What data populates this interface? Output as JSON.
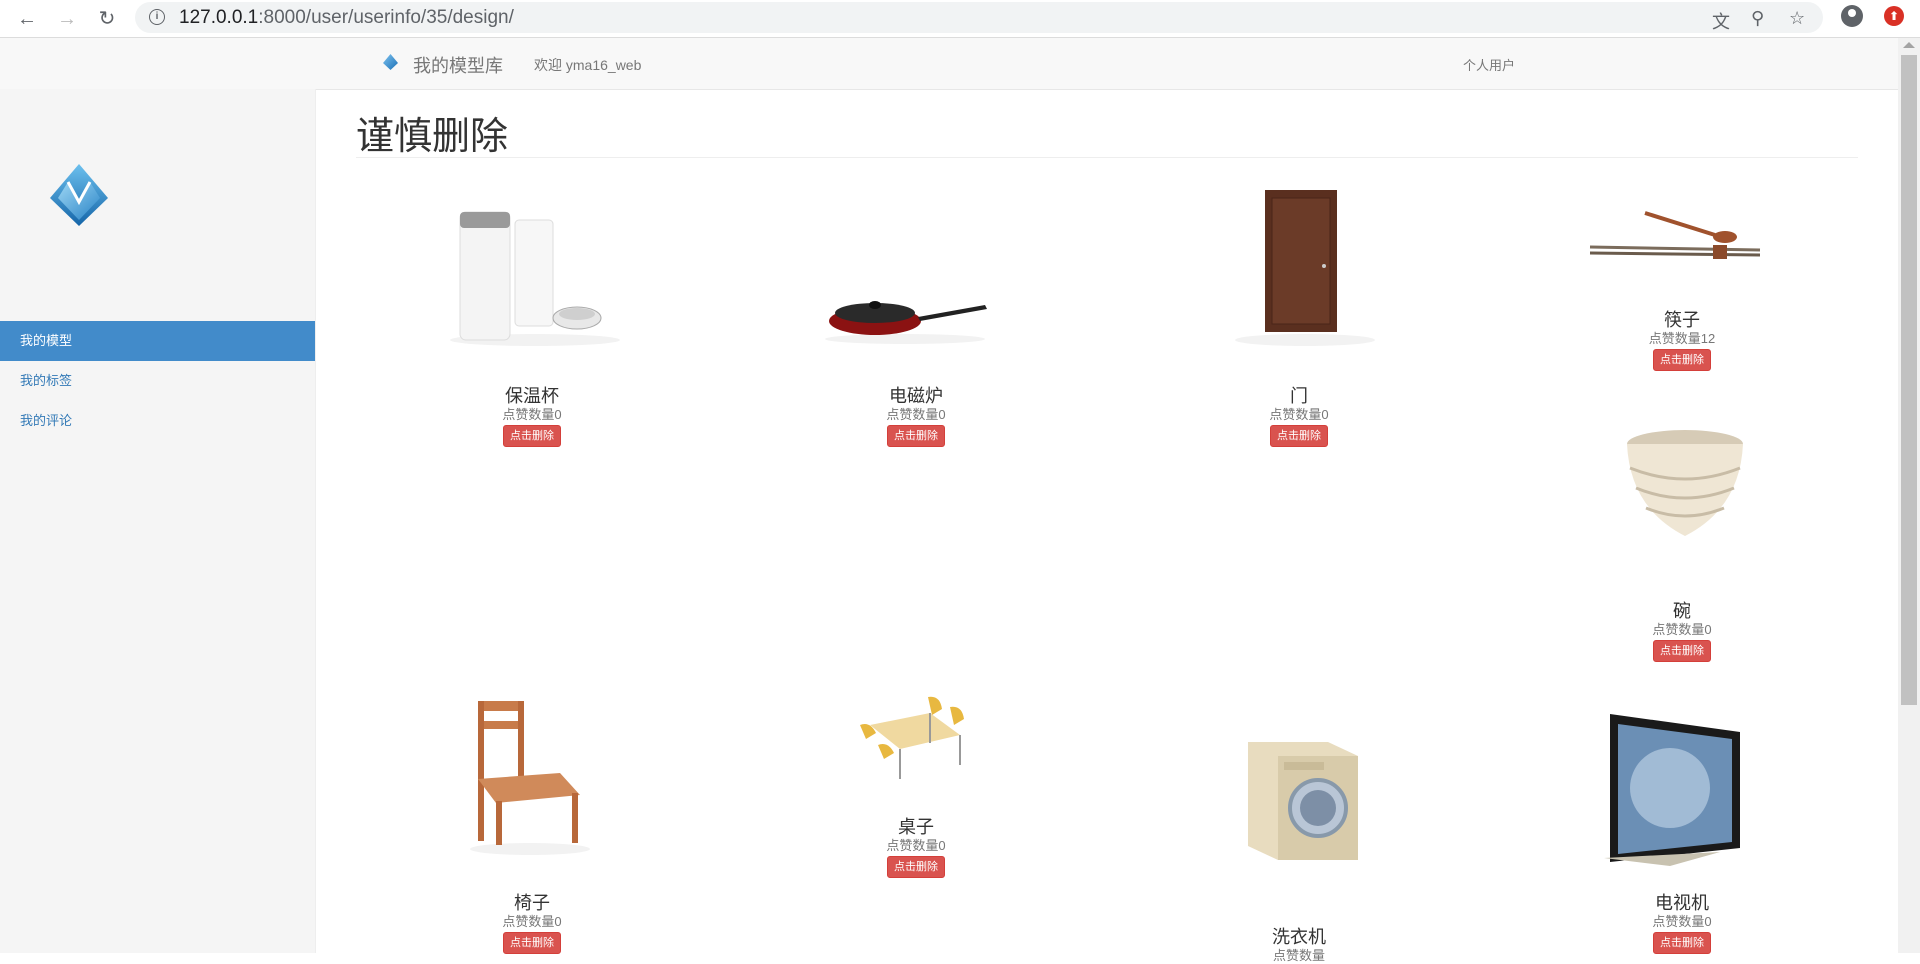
{
  "browser": {
    "url_host": "127.0.0.1",
    "url_rest": ":8000/user/userinfo/35/design/"
  },
  "navbar": {
    "brand": "我的模型库",
    "welcome": "欢迎 yma16_web",
    "user_type": "个人用户"
  },
  "sidebar": {
    "items": [
      {
        "label": "我的模型",
        "active": true
      },
      {
        "label": "我的标签",
        "active": false
      },
      {
        "label": "我的评论",
        "active": false
      }
    ]
  },
  "main": {
    "title": "谨慎删除",
    "likes_label": "点赞数量",
    "delete_label": "点击删除",
    "models": [
      {
        "name": "保温杯",
        "likes": "0"
      },
      {
        "name": "电磁炉",
        "likes": "0"
      },
      {
        "name": "门",
        "likes": "0"
      },
      {
        "name": "筷子",
        "likes": "12"
      },
      {
        "name": "碗",
        "likes": "0"
      },
      {
        "name": "椅子",
        "likes": "0"
      },
      {
        "name": "桌子",
        "likes": "0"
      },
      {
        "name": "洗衣机",
        "likes": ""
      },
      {
        "name": "电视机",
        "likes": "0"
      }
    ]
  }
}
